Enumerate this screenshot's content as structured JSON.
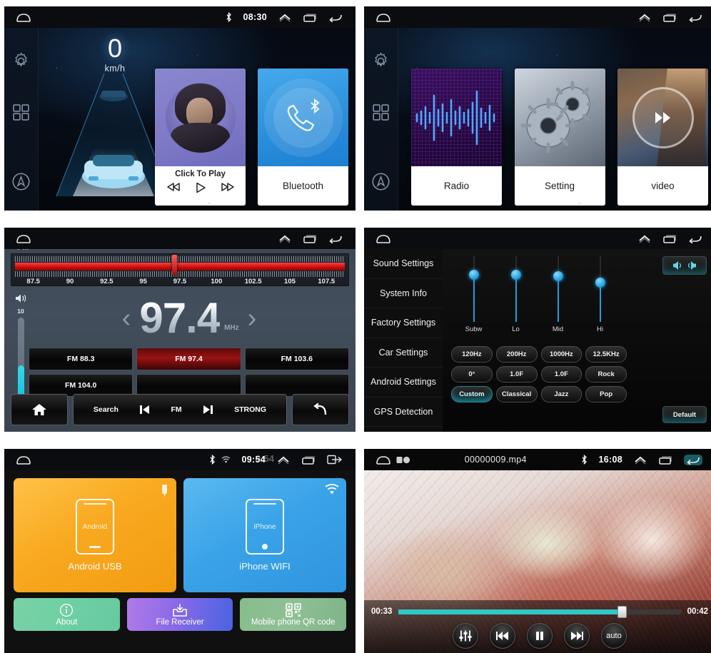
{
  "panels": {
    "home": {
      "statusbar": {
        "bluetooth_icon": "bluetooth-icon",
        "time": "08:30"
      },
      "rail": [
        {
          "name": "settings",
          "icon": "gear-icon"
        },
        {
          "name": "apps",
          "icon": "apps-grid-icon"
        },
        {
          "name": "navigation",
          "icon": "navigation-compass-icon"
        }
      ],
      "speed": {
        "value": "0",
        "unit": "km/h"
      },
      "media_tile": {
        "caption": "Click To Play",
        "prev_icon": "rewind-icon",
        "play_icon": "play-icon",
        "next_icon": "fast-forward-icon"
      },
      "bluetooth_tile": {
        "label": "Bluetooth",
        "icon": "bluetooth-phone-icon"
      },
      "pager": {
        "pages": 2,
        "current": 1
      }
    },
    "apps": {
      "statusbar": {},
      "rail": [
        {
          "name": "settings",
          "icon": "gear-icon"
        },
        {
          "name": "apps",
          "icon": "apps-grid-icon"
        },
        {
          "name": "navigation",
          "icon": "navigation-compass-icon"
        }
      ],
      "tiles": [
        {
          "label": "Radio",
          "art": "waveform"
        },
        {
          "label": "Setting",
          "art": "gears"
        },
        {
          "label": "video",
          "art": "movie"
        }
      ],
      "pager": {
        "pages": 2,
        "current": 2
      }
    },
    "radio": {
      "statusbar": {},
      "band": "FM",
      "frequency": "97.4",
      "unit": "MHz",
      "scale": [
        "87.5",
        "90",
        "92.5",
        "95",
        "97.5",
        "100",
        "102.5",
        "105",
        "107.5"
      ],
      "volume": {
        "label": "10",
        "icon": "volume-icon",
        "level": 42
      },
      "presets": [
        {
          "label": "FM 88.3",
          "active": false
        },
        {
          "label": "FM 97.4",
          "active": true
        },
        {
          "label": "FM 103.6",
          "active": false
        },
        {
          "label": "FM 104.0",
          "active": false
        },
        {
          "label": "",
          "active": false
        },
        {
          "label": "",
          "active": false
        }
      ],
      "toolbar": {
        "home_icon": "home-icon",
        "search": "Search",
        "prev_icon": "skip-previous-icon",
        "band": "FM",
        "next_icon": "skip-next-icon",
        "strong": "STRONG",
        "back_icon": "back-arrow-icon"
      }
    },
    "sound_settings": {
      "statusbar": {},
      "menu": [
        "Sound Settings",
        "System Info",
        "Factory Settings",
        "Car Settings",
        "Android Settings",
        "GPS Detection"
      ],
      "selected_menu": "Sound Settings",
      "balance_button_icon": "balance-speakers-icon",
      "sliders": [
        {
          "label": "Subw",
          "value": 72
        },
        {
          "label": "Lo",
          "value": 72
        },
        {
          "label": "Mid",
          "value": 70
        },
        {
          "label": "Hi",
          "value": 60
        }
      ],
      "rows": [
        [
          {
            "label": "120Hz",
            "active": false
          },
          {
            "label": "200Hz",
            "active": false
          },
          {
            "label": "1000Hz",
            "active": false
          },
          {
            "label": "12.5KHz",
            "active": false
          }
        ],
        [
          {
            "label": "0°",
            "active": false
          },
          {
            "label": "1.0F",
            "active": false
          },
          {
            "label": "1.0F",
            "active": false
          },
          {
            "label": "Rock",
            "active": false
          }
        ],
        [
          {
            "label": "Custom",
            "active": true
          },
          {
            "label": "Classical",
            "active": false
          },
          {
            "label": "Jazz",
            "active": false
          },
          {
            "label": "Pop",
            "active": false
          }
        ]
      ],
      "default_button": "Default"
    },
    "mirror_link": {
      "statusbar": {
        "bluetooth_icon": "bluetooth-icon",
        "wifi_icon": "wifi-icon",
        "time": "09:54",
        "ghost_time": "9:54"
      },
      "cards": [
        {
          "label": "Android USB",
          "device": "Android",
          "corner_icon": "usb-icon"
        },
        {
          "label": "iPhone WIFI",
          "device": "iPhone",
          "corner_icon": "wifi-icon"
        }
      ],
      "actions": [
        {
          "label": "About",
          "icon": "info-icon"
        },
        {
          "label": "File Receiver",
          "icon": "file-download-icon"
        },
        {
          "label": "Mobile phone QR code",
          "icon": "qr-code-icon"
        }
      ]
    },
    "video": {
      "statusbar": {
        "file_name": "00000009.mp4",
        "bluetooth_icon": "bluetooth-icon",
        "time": "16:08"
      },
      "player": {
        "elapsed": "00:33",
        "duration": "00:42",
        "progress": 79,
        "controls": [
          {
            "name": "equalizer",
            "icon": "equalizer-icon",
            "label": ""
          },
          {
            "name": "previous",
            "icon": "skip-previous-icon",
            "label": ""
          },
          {
            "name": "pause",
            "icon": "pause-icon",
            "label": ""
          },
          {
            "name": "next",
            "icon": "skip-next-icon",
            "label": ""
          },
          {
            "name": "auto",
            "icon": "auto-icon",
            "label": "auto"
          }
        ]
      }
    }
  },
  "colors": {
    "accent_cyan": "#2fc8c8",
    "android_orange": "#f8a91f",
    "iphone_blue": "#3aa3e8",
    "radio_red": "#c40d0d",
    "eq_blue": "#1f9fe0"
  }
}
